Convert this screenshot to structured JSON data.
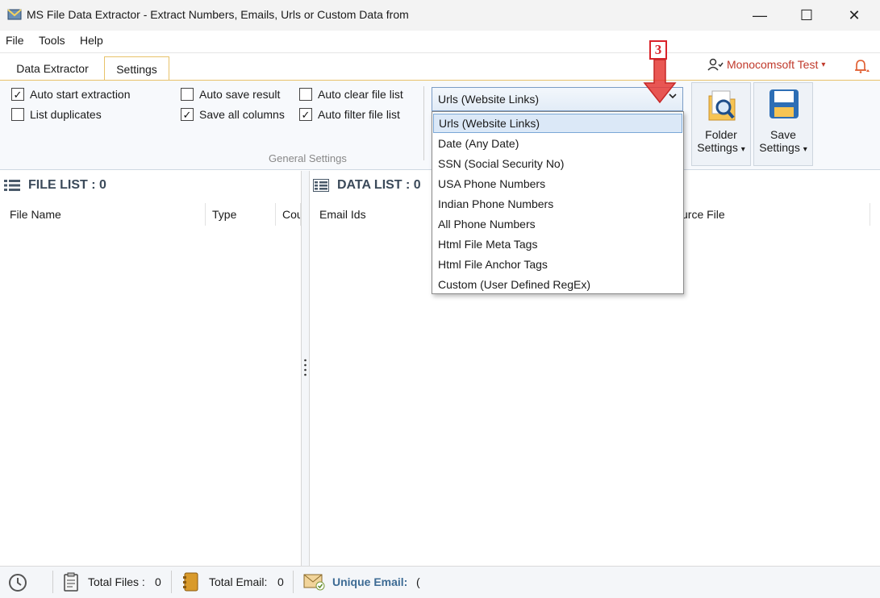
{
  "window": {
    "title": "MS File Data Extractor - Extract Numbers, Emails, Urls or Custom Data from",
    "minimize": "—",
    "maximize": "☐",
    "close": "✕"
  },
  "menu": {
    "file": "File",
    "tools": "Tools",
    "help": "Help"
  },
  "tabs": {
    "extractor": "Data Extractor",
    "settings": "Settings"
  },
  "user": {
    "name": "Monocomsoft Test",
    "caret": "▾"
  },
  "settings": {
    "auto_start": {
      "label": "Auto start extraction",
      "checked": "✓"
    },
    "list_duplicates": {
      "label": "List duplicates",
      "checked": ""
    },
    "auto_save": {
      "label": "Auto save result",
      "checked": ""
    },
    "save_all_columns": {
      "label": "Save all columns",
      "checked": "✓"
    },
    "auto_clear": {
      "label": "Auto clear file list",
      "checked": ""
    },
    "auto_filter": {
      "label": "Auto filter file list",
      "checked": "✓"
    },
    "group_caption": "General Settings"
  },
  "extract_type": {
    "selected": "Urls (Website Links)",
    "options": [
      "Urls (Website Links)",
      "Date (Any Date)",
      "SSN (Social Security No)",
      "USA Phone Numbers",
      "Indian Phone Numbers",
      "All Phone Numbers",
      "Html File Meta Tags",
      "Html File Anchor Tags",
      "Custom (User Defined RegEx)"
    ]
  },
  "buttons": {
    "folder_settings": {
      "line1": "Folder",
      "line2": "Settings"
    },
    "save_settings": {
      "line1": "Save",
      "line2": "Settings"
    },
    "caret": "▾"
  },
  "annotation": {
    "step": "3"
  },
  "file_list": {
    "title": "FILE LIST : 0",
    "columns": [
      "File Name",
      "Type",
      "Cou"
    ]
  },
  "data_list": {
    "title": "DATA LIST : 0",
    "columns": [
      "Email Ids",
      "urce File"
    ]
  },
  "status": {
    "total_files_label": "Total Files :",
    "total_files_value": "0",
    "total_email_label": "Total Email:",
    "total_email_value": "0",
    "unique_email_label": "Unique Email:",
    "unique_email_value": "("
  },
  "colors": {
    "accent_tab": "#e8c26a",
    "user_name": "#c0392b",
    "annotation": "#d9232a",
    "unique_email": "#3d6b94"
  }
}
